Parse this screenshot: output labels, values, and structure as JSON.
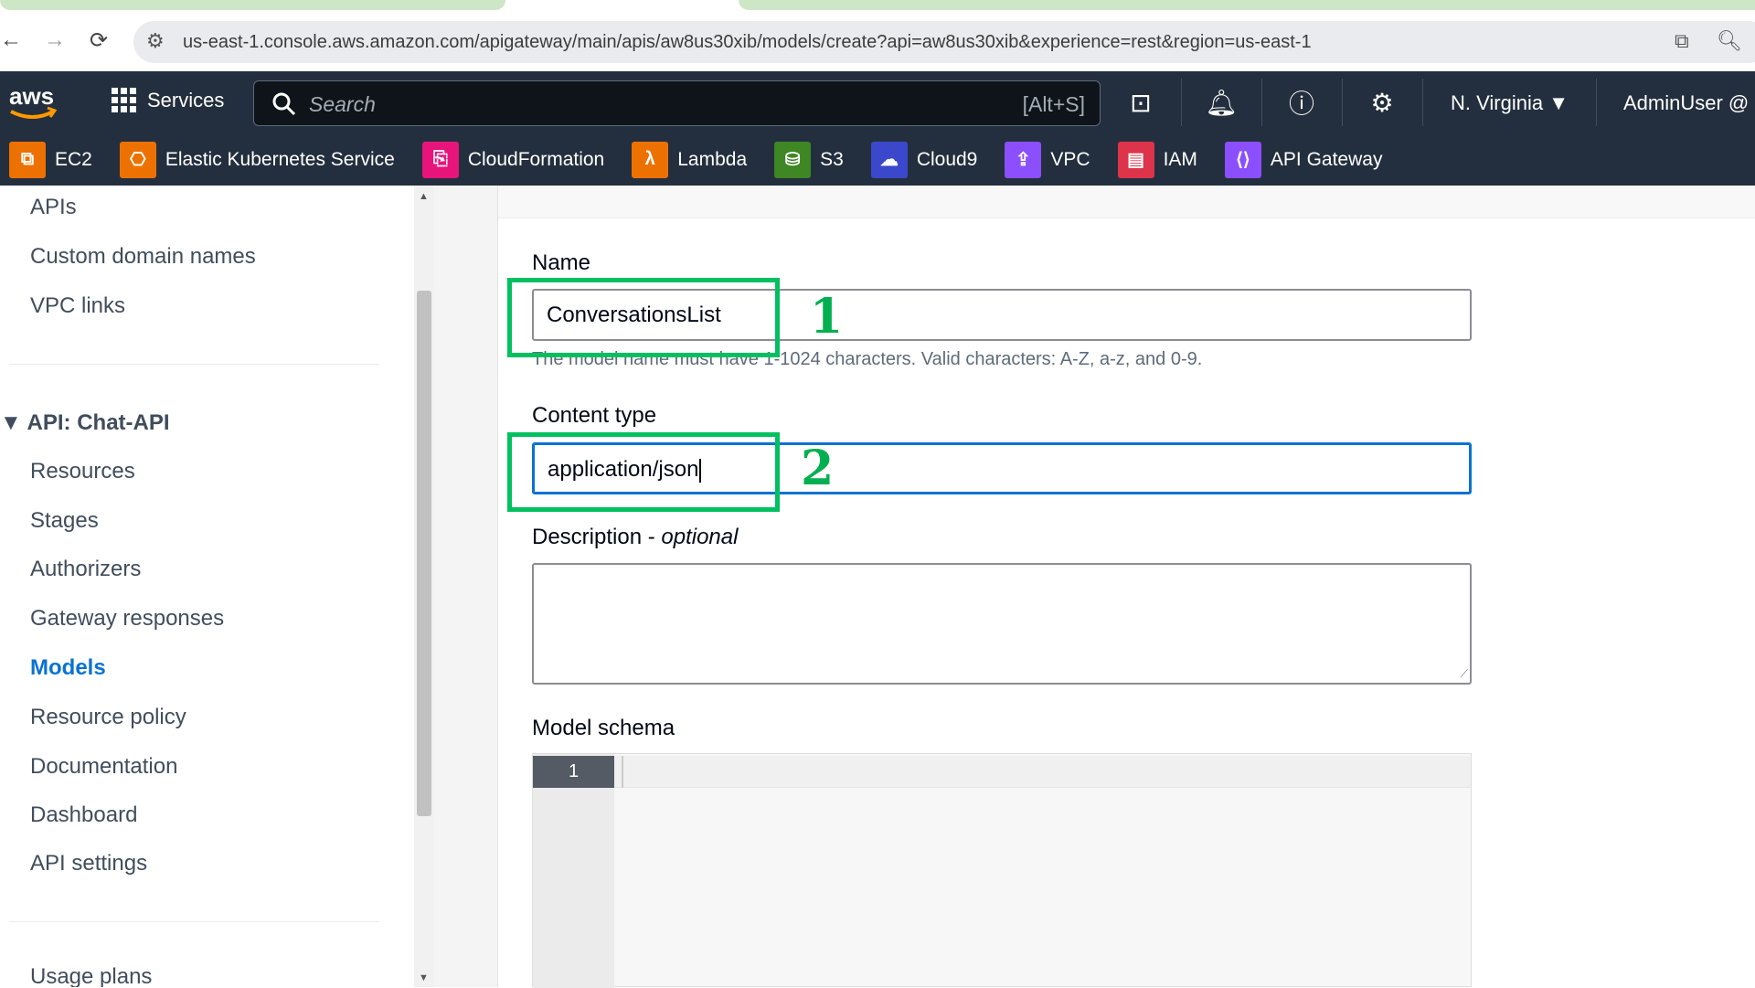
{
  "browser": {
    "url": "us-east-1.console.aws.amazon.com/apigateway/main/apis/aw8us30xib/models/create?api=aw8us30xib&experience=rest&region=us-east-1"
  },
  "topnav": {
    "logo": "aws",
    "services_label": "Services",
    "search_placeholder": "Search",
    "search_shortcut": "[Alt+S]",
    "region": "N. Virginia",
    "user": "AdminUser @"
  },
  "favorites": [
    {
      "label": "EC2",
      "color": "#ed7100"
    },
    {
      "label": "Elastic Kubernetes Service",
      "color": "#ed7100"
    },
    {
      "label": "CloudFormation",
      "color": "#e7157b"
    },
    {
      "label": "Lambda",
      "color": "#ed7100"
    },
    {
      "label": "S3",
      "color": "#3f8624"
    },
    {
      "label": "Cloud9",
      "color": "#3b48cc"
    },
    {
      "label": "VPC",
      "color": "#8c4fff"
    },
    {
      "label": "IAM",
      "color": "#dd344c"
    },
    {
      "label": "API Gateway",
      "color": "#8c4fff"
    }
  ],
  "sidebar": {
    "top_items": [
      "APIs",
      "Custom domain names",
      "VPC links"
    ],
    "api_header": "API: Chat-API",
    "api_items": [
      "Resources",
      "Stages",
      "Authorizers",
      "Gateway responses",
      "Models",
      "Resource policy",
      "Documentation",
      "Dashboard",
      "API settings"
    ],
    "active": "Models",
    "bottom_items": [
      "Usage plans"
    ]
  },
  "form": {
    "name_label": "Name",
    "name_value": "ConversationsList",
    "name_helper": "The model name must have 1-1024 characters. Valid characters: A-Z, a-z, and 0-9.",
    "content_type_label": "Content type",
    "content_type_value": "application/json",
    "description_label": "Description - ",
    "description_optional": "optional",
    "schema_label": "Model schema",
    "schema_line": "1"
  },
  "annotations": [
    "1",
    "2"
  ]
}
